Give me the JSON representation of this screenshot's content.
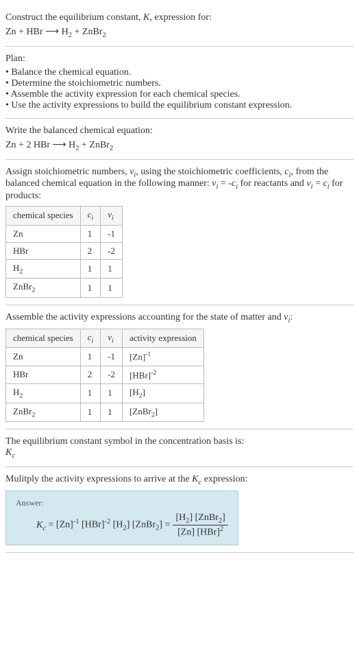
{
  "prompt": {
    "line1": "Construct the equilibrium constant, K, expression for:",
    "eq": "Zn + HBr ⟶ H₂ + ZnBr₂"
  },
  "plan": {
    "heading": "Plan:",
    "items": [
      "• Balance the chemical equation.",
      "• Determine the stoichiometric numbers.",
      "• Assemble the activity expression for each chemical species.",
      "• Use the activity expressions to build the equilibrium constant expression."
    ]
  },
  "balanced": {
    "heading": "Write the balanced chemical equation:",
    "eq": "Zn + 2 HBr ⟶ H₂ + ZnBr₂"
  },
  "stoich": {
    "text1": "Assign stoichiometric numbers, νᵢ, using the stoichiometric coefficients, cᵢ, from the balanced chemical equation in the following manner: νᵢ = -cᵢ for reactants and νᵢ = cᵢ for products:",
    "headers": [
      "chemical species",
      "cᵢ",
      "νᵢ"
    ],
    "rows": [
      [
        "Zn",
        "1",
        "-1"
      ],
      [
        "HBr",
        "2",
        "-2"
      ],
      [
        "H₂",
        "1",
        "1"
      ],
      [
        "ZnBr₂",
        "1",
        "1"
      ]
    ]
  },
  "activity": {
    "heading": "Assemble the activity expressions accounting for the state of matter and νᵢ:",
    "headers": [
      "chemical species",
      "cᵢ",
      "νᵢ",
      "activity expression"
    ],
    "rows": [
      [
        "Zn",
        "1",
        "-1",
        "[Zn]⁻¹"
      ],
      [
        "HBr",
        "2",
        "-2",
        "[HBr]⁻²"
      ],
      [
        "H₂",
        "1",
        "1",
        "[H₂]"
      ],
      [
        "ZnBr₂",
        "1",
        "1",
        "[ZnBr₂]"
      ]
    ]
  },
  "symbol": {
    "line": "The equilibrium constant symbol in the concentration basis is:",
    "val": "K_c"
  },
  "final": {
    "heading": "Mulitply the activity expressions to arrive at the K_c expression:",
    "answer_label": "Answer:",
    "lhs": "K_c = [Zn]⁻¹ [HBr]⁻² [H₂] [ZnBr₂] =",
    "num": "[H₂] [ZnBr₂]",
    "den": "[Zn] [HBr]²"
  }
}
